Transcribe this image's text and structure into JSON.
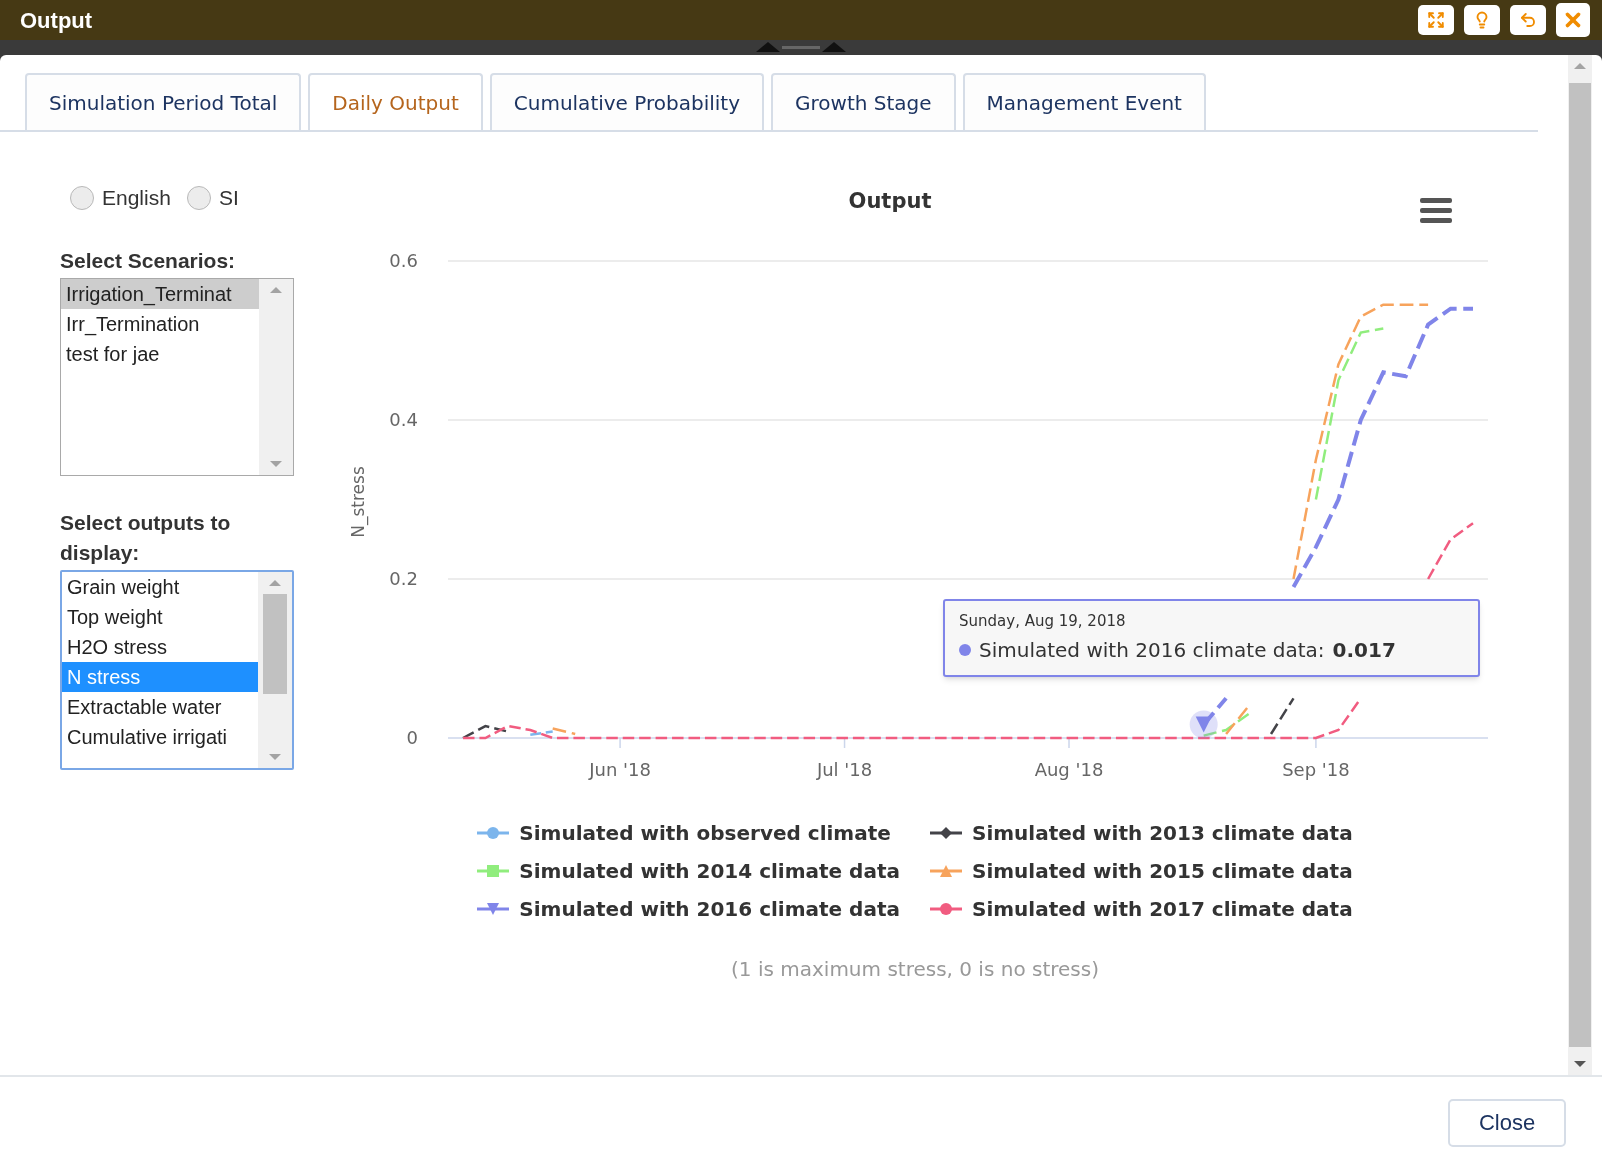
{
  "window": {
    "title": "Output",
    "buttons": [
      {
        "kind": "maximize"
      },
      {
        "kind": "tips"
      },
      {
        "kind": "undo"
      },
      {
        "kind": "close"
      }
    ]
  },
  "tabs": [
    {
      "label": "Simulation Period Total",
      "selected": false
    },
    {
      "label": "Daily Output",
      "selected": true
    },
    {
      "label": "Cumulative Probability",
      "selected": false
    },
    {
      "label": "Growth Stage",
      "selected": false
    },
    {
      "label": "Management Event",
      "selected": false
    }
  ],
  "units": [
    {
      "label": "English",
      "selected": false
    },
    {
      "label": "SI",
      "selected": false
    }
  ],
  "scenarios": {
    "label": "Select Scenarios:",
    "focused": false,
    "items": [
      {
        "label": "Irrigation_Terminat",
        "selected": true
      },
      {
        "label": "Irr_Termination",
        "selected": false
      },
      {
        "label": "test for jae",
        "selected": false
      }
    ]
  },
  "outputs": {
    "label": "Select outputs to display:",
    "focused": true,
    "items": [
      {
        "label": "Grain weight",
        "selected": false
      },
      {
        "label": "Top weight",
        "selected": false
      },
      {
        "label": "H2O stress",
        "selected": false
      },
      {
        "label": "N stress",
        "selected": true
      },
      {
        "label": "Extractable water",
        "selected": false
      },
      {
        "label": "Cumulative irrigati",
        "selected": false
      }
    ]
  },
  "chart": {
    "chart_data": {
      "type": "line",
      "title": "Output",
      "ylabel": "N_stress",
      "categories": [
        null,
        null,
        null,
        null,
        null,
        null,
        null,
        "Jun '18",
        null,
        null,
        null,
        null,
        null,
        null,
        null,
        null,
        null,
        "Jul '18",
        null,
        null,
        null,
        null,
        null,
        null,
        null,
        null,
        null,
        "Aug '18",
        null,
        null,
        null,
        null,
        null,
        null,
        null,
        null,
        null,
        null,
        "Sep '18",
        null,
        null,
        null,
        null,
        null,
        null,
        null
      ],
      "ylim": [
        0,
        0.6
      ],
      "yticks": [
        {
          "value": 0,
          "label": "0"
        },
        {
          "value": 0.2,
          "label": "0.2"
        },
        {
          "value": 0.4,
          "label": "0.4"
        },
        {
          "value": 0.6,
          "label": "0.6"
        }
      ],
      "series": [
        {
          "name": "Simulated with observed climate",
          "color": "#7cb5ec",
          "line_style": "dashed",
          "values": [
            null,
            null,
            null,
            0.004,
            0.008,
            null,
            null,
            null,
            null,
            null,
            null,
            null,
            null,
            null,
            null,
            null,
            null,
            null,
            null,
            null,
            null,
            null,
            null,
            null,
            null,
            null,
            null,
            null,
            null,
            null,
            null,
            null,
            null,
            null,
            null,
            null,
            null,
            null,
            null,
            null,
            null,
            null,
            null,
            null,
            null,
            null
          ]
        },
        {
          "name": "Simulated with 2013 climate data",
          "color": "#434348",
          "line_style": "dashed",
          "values": [
            0,
            0.015,
            0.008,
            null,
            null,
            null,
            null,
            null,
            null,
            null,
            null,
            null,
            null,
            null,
            null,
            null,
            null,
            null,
            null,
            null,
            null,
            null,
            null,
            null,
            null,
            null,
            null,
            null,
            null,
            null,
            null,
            null,
            null,
            null,
            null,
            null,
            0.005,
            0.05,
            null,
            null,
            null,
            null,
            null,
            null,
            null,
            null
          ]
        },
        {
          "name": "Simulated with 2014 climate data",
          "color": "#90ed7d",
          "line_style": "dashed",
          "values": [
            null,
            null,
            null,
            null,
            null,
            null,
            null,
            null,
            null,
            null,
            null,
            null,
            null,
            null,
            null,
            null,
            null,
            null,
            null,
            null,
            null,
            null,
            null,
            null,
            null,
            null,
            null,
            null,
            null,
            null,
            null,
            null,
            null,
            0.003,
            0.01,
            0.03,
            null,
            null,
            0.3,
            0.45,
            0.51,
            0.515,
            null,
            null,
            null,
            null
          ]
        },
        {
          "name": "Simulated with 2015 climate data",
          "color": "#f7a35c",
          "line_style": "dashed",
          "values": [
            null,
            null,
            null,
            null,
            0.012,
            0.005,
            null,
            null,
            null,
            null,
            null,
            null,
            null,
            null,
            null,
            null,
            null,
            null,
            null,
            null,
            null,
            null,
            null,
            null,
            null,
            null,
            null,
            null,
            null,
            null,
            null,
            null,
            null,
            null,
            0.005,
            0.04,
            null,
            0.2,
            0.35,
            0.47,
            0.53,
            0.545,
            0.545,
            0.545,
            null,
            null
          ]
        },
        {
          "name": "Simulated with 2016 climate data",
          "color": "#8085e9",
          "line_style": "dashed",
          "values": [
            null,
            null,
            null,
            null,
            null,
            null,
            null,
            null,
            null,
            null,
            null,
            null,
            null,
            null,
            null,
            null,
            null,
            null,
            null,
            null,
            null,
            null,
            null,
            null,
            null,
            null,
            null,
            null,
            null,
            null,
            null,
            null,
            null,
            0.017,
            0.05,
            null,
            null,
            0.19,
            0.24,
            0.3,
            0.4,
            0.46,
            0.455,
            0.52,
            0.54,
            0.54
          ]
        },
        {
          "name": "Simulated with 2017 climate data",
          "color": "#f15c80",
          "line_style": "dashed",
          "values": [
            0,
            0,
            0.015,
            0.01,
            0,
            0,
            0,
            0,
            0,
            0,
            0,
            0,
            0,
            0,
            0,
            0,
            0,
            0,
            0,
            0,
            0,
            0,
            0,
            0,
            0,
            0,
            0,
            0,
            0,
            0,
            0,
            0,
            0,
            0,
            0,
            0,
            0,
            0,
            0,
            0.01,
            0.05,
            null,
            null,
            0.2,
            0.25,
            0.27
          ]
        }
      ]
    },
    "legend": [
      {
        "kind": "circle"
      },
      {
        "kind": "diamond"
      },
      {
        "kind": "square"
      },
      {
        "kind": "triangle"
      },
      {
        "kind": "triangle-down"
      },
      {
        "kind": "circle"
      }
    ],
    "tooltip": {
      "date": "Sunday, Aug 19, 2018",
      "label": "Simulated with 2016 climate data:",
      "value": "0.017"
    },
    "caption": "(1 is maximum stress, 0 is no stress)"
  },
  "footer": {
    "close": "Close"
  }
}
